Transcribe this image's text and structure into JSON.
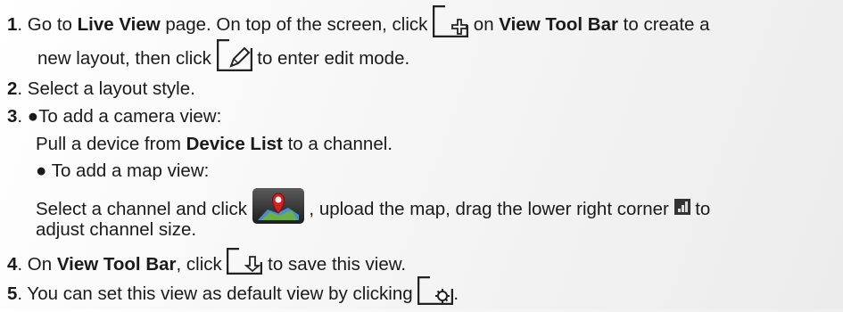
{
  "steps": {
    "s1": {
      "num": "1",
      "t1": ". Go to ",
      "b1": "Live View",
      "t2": " page. On top of the screen, click ",
      "t3": " on ",
      "b2": "View Tool Bar",
      "t4": " to create a",
      "cont_a": "new layout, then click ",
      "cont_b": " to enter edit mode."
    },
    "s2": {
      "num": "2",
      "text": ". Select a layout style."
    },
    "s3": {
      "num": "3",
      "bullet1": ". ●To add a camera view:",
      "pull_a": "Pull a device from ",
      "pull_b": "Device List",
      "pull_c": " to a channel.",
      "bullet2": "● To add a map view:",
      "map_a": "Select a channel and click ",
      "map_b": " , upload the map, drag the lower right corner ",
      "map_c": " to",
      "map_d": "adjust channel size."
    },
    "s4": {
      "num": "4",
      "t1": ". On ",
      "b1": "View Tool Bar",
      "t2": ", click ",
      "t3": " to save this view."
    },
    "s5": {
      "num": "5",
      "t1": ". You can set this view as default view by clicking ",
      "t2": "."
    }
  },
  "icons": {
    "new_layout": "new-layout-icon",
    "edit_mode": "edit-pencil-icon",
    "map": "map-pin-icon",
    "resize": "resize-corner-icon",
    "save": "save-view-icon",
    "default": "set-default-icon"
  },
  "colors": {
    "map_pin": "#d42020",
    "icon_border": "#222222"
  }
}
